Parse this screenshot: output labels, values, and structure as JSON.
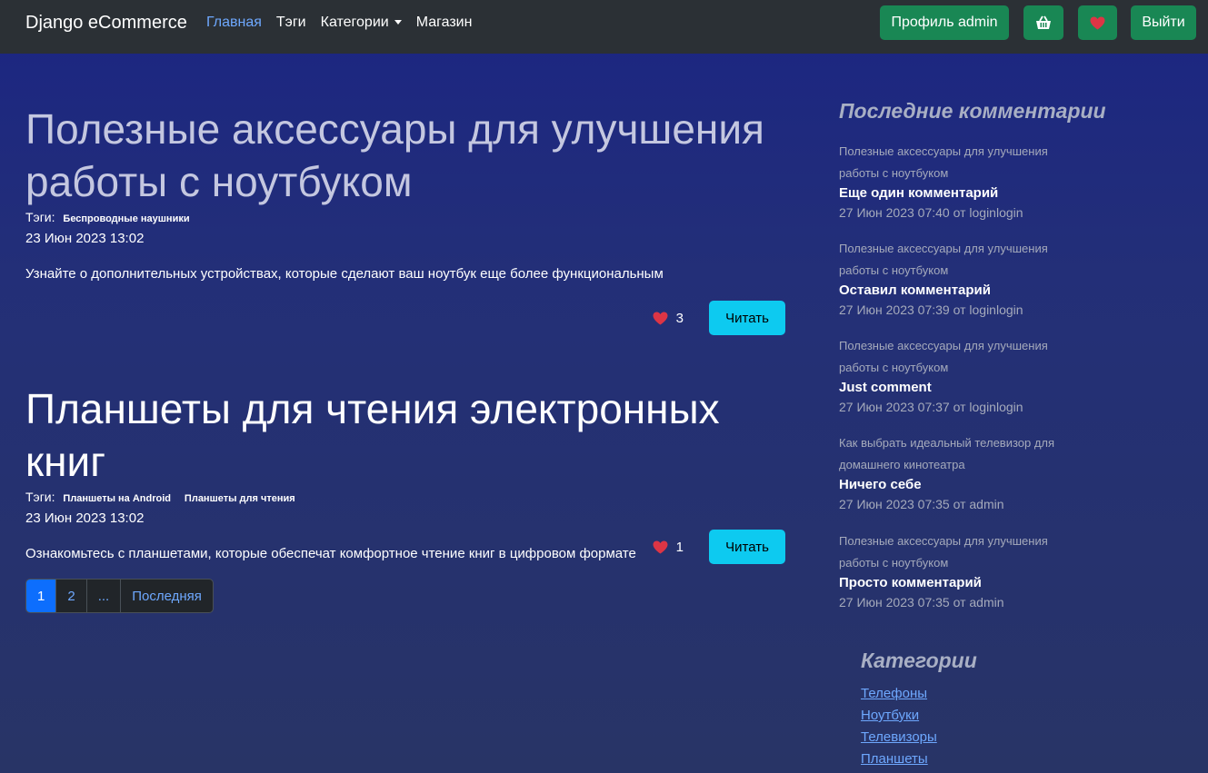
{
  "nav": {
    "brand": "Django eCommerce",
    "links": [
      "Главная",
      "Тэги",
      "Категории",
      "Магазин"
    ],
    "profile": "Профиль admin",
    "logout": "Выйти"
  },
  "posts": [
    {
      "title": "Полезные аксессуары для улучшения работы с ноутбуком",
      "tags_label": "Тэги:",
      "tags": [
        "Беспроводные наушники"
      ],
      "date": "23 Июн 2023 13:02",
      "excerpt": "Узнайте о дополнительных устройствах, которые сделают ваш ноутбук еще более функциональным",
      "likes": "3",
      "read": "Читать"
    },
    {
      "title": "Планшеты для чтения электронных книг",
      "tags_label": "Тэги:",
      "tags": [
        "Планшеты на Android",
        "Планшеты для чтения"
      ],
      "date": "23 Июн 2023 13:02",
      "excerpt": "Ознакомьтесь с планшетами, которые обеспечат комфортное чтение книг в цифровом формате",
      "likes": "1",
      "read": "Читать"
    }
  ],
  "pagination": [
    "1",
    "2",
    "...",
    "Последняя"
  ],
  "sidebar": {
    "title": "Последние комментарии",
    "comments": [
      {
        "post": "Полезные аксессуары для улучшения работы с ноутбуком",
        "text": "Еще один комментарий",
        "meta": "27 Июн 2023 07:40 от loginlogin"
      },
      {
        "post": "Полезные аксессуары для улучшения работы с ноутбуком",
        "text": "Оставил комментарий",
        "meta": "27 Июн 2023 07:39 от loginlogin"
      },
      {
        "post": "Полезные аксессуары для улучшения работы с ноутбуком",
        "text": "Just comment",
        "meta": "27 Июн 2023 07:37 от loginlogin"
      },
      {
        "post": "Как выбрать идеальный телевизор для домашнего кинотеатра",
        "text": "Ничего себе",
        "meta": "27 Июн 2023 07:35 от admin"
      },
      {
        "post": "Полезные аксессуары для улучшения работы с ноутбуком",
        "text": "Просто комментарий",
        "meta": "27 Июн 2023 07:35 от admin"
      }
    ],
    "categories_title": "Категории",
    "categories": [
      "Телефоны",
      "Ноутбуки",
      "Телевизоры",
      "Планшеты"
    ]
  },
  "colors": {
    "navbar": "#2b3035",
    "success": "#198754",
    "info": "#0dcaf0",
    "primary": "#0d6efd",
    "link": "#6ea8fe",
    "heart": "#dc3545"
  }
}
